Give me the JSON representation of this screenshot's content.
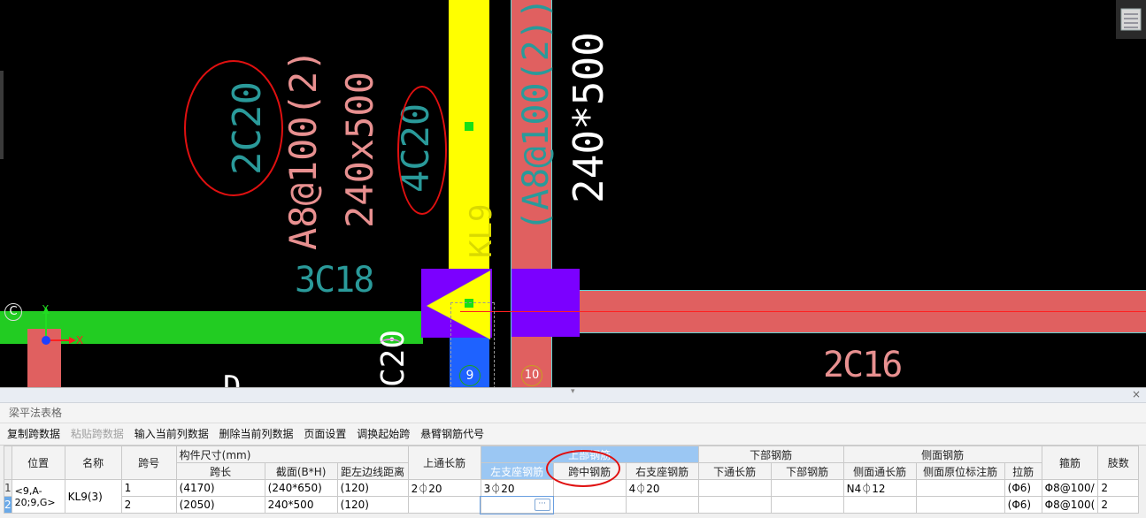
{
  "canvas": {
    "annotations": {
      "rebar_2c20": "2C20",
      "stirrup_left": "A8@100(2)",
      "section_left": "240x500",
      "rebar_4c20": "4C20",
      "stirrup_right": "(A8@100(2))",
      "section_right": "240*500",
      "rebar_3c18": "3C18",
      "rebar_2c16": "2C16",
      "partial_20": "C20",
      "partial_top": "KL9",
      "partial_d": "D"
    },
    "axis_labels": {
      "row_c": "C",
      "col_9": "9",
      "col_10": "10",
      "ucs_x": "X",
      "ucs_y": "Y"
    }
  },
  "panel": {
    "title": "梁平法表格",
    "close_glyph": "×",
    "toolbar": {
      "copy_span": "复制跨数据",
      "paste_span": "粘贴跨数据",
      "input_col": "输入当前列数据",
      "delete_col": "删除当前列数据",
      "page_setup": "页面设置",
      "swap_start": "调换起始跨",
      "cantilever_code": "悬臂钢筋代号"
    },
    "headers": {
      "position": "位置",
      "name": "名称",
      "span_no": "跨号",
      "size_group": "构件尺寸(mm)",
      "span_len": "跨长",
      "section": "截面(B*H)",
      "edge_dist": "距左边线距离",
      "top_through": "上通长筋",
      "top_group": "上部钢筋",
      "left_support": "左支座钢筋",
      "mid_span": "跨中钢筋",
      "right_support": "右支座钢筋",
      "bottom_group": "下部钢筋",
      "bottom_through": "下通长筋",
      "bottom_rebar": "下部钢筋",
      "side_group": "侧面钢筋",
      "side_through": "侧面通长筋",
      "side_local": "侧面原位标注筋",
      "tie": "拉筋",
      "stirrup": "箍筋",
      "legs": "肢数"
    },
    "rows": [
      {
        "num": "1",
        "position": "<9,A-20;9,G>",
        "name": "KL9(3)",
        "span_no": "1",
        "span_len": "(4170)",
        "section": "(240*650)",
        "edge_dist": "(120)",
        "top_through": "2⏀20",
        "left_support": "3⏀20",
        "mid_span": "",
        "right_support": "4⏀20",
        "bottom_through": "",
        "bottom_rebar": "",
        "side_through": "N4⏀12",
        "side_local": "",
        "tie": "(Φ6)",
        "stirrup": "Φ8@100/",
        "legs": "2"
      },
      {
        "num": "2",
        "span_no": "2",
        "span_len": "(2050)",
        "section": "240*500",
        "edge_dist": "(120)",
        "top_through": "",
        "left_support": "",
        "mid_span": "",
        "right_support": "",
        "bottom_through": "",
        "bottom_rebar": "",
        "side_through": "",
        "side_local": "",
        "tie": "(Φ6)",
        "stirrup": "Φ8@100(",
        "legs": "2"
      }
    ],
    "edit_button": "···"
  },
  "colors": {
    "beam_green": "#22cc22",
    "beam_yellow": "#ffff00",
    "column_purple": "#7b00ff",
    "beam_red": "#e06060",
    "text_cyan": "#2a9a9a",
    "text_pink": "#e89090",
    "highlight_red": "#e01010",
    "header_selected": "#9bc7f3"
  }
}
